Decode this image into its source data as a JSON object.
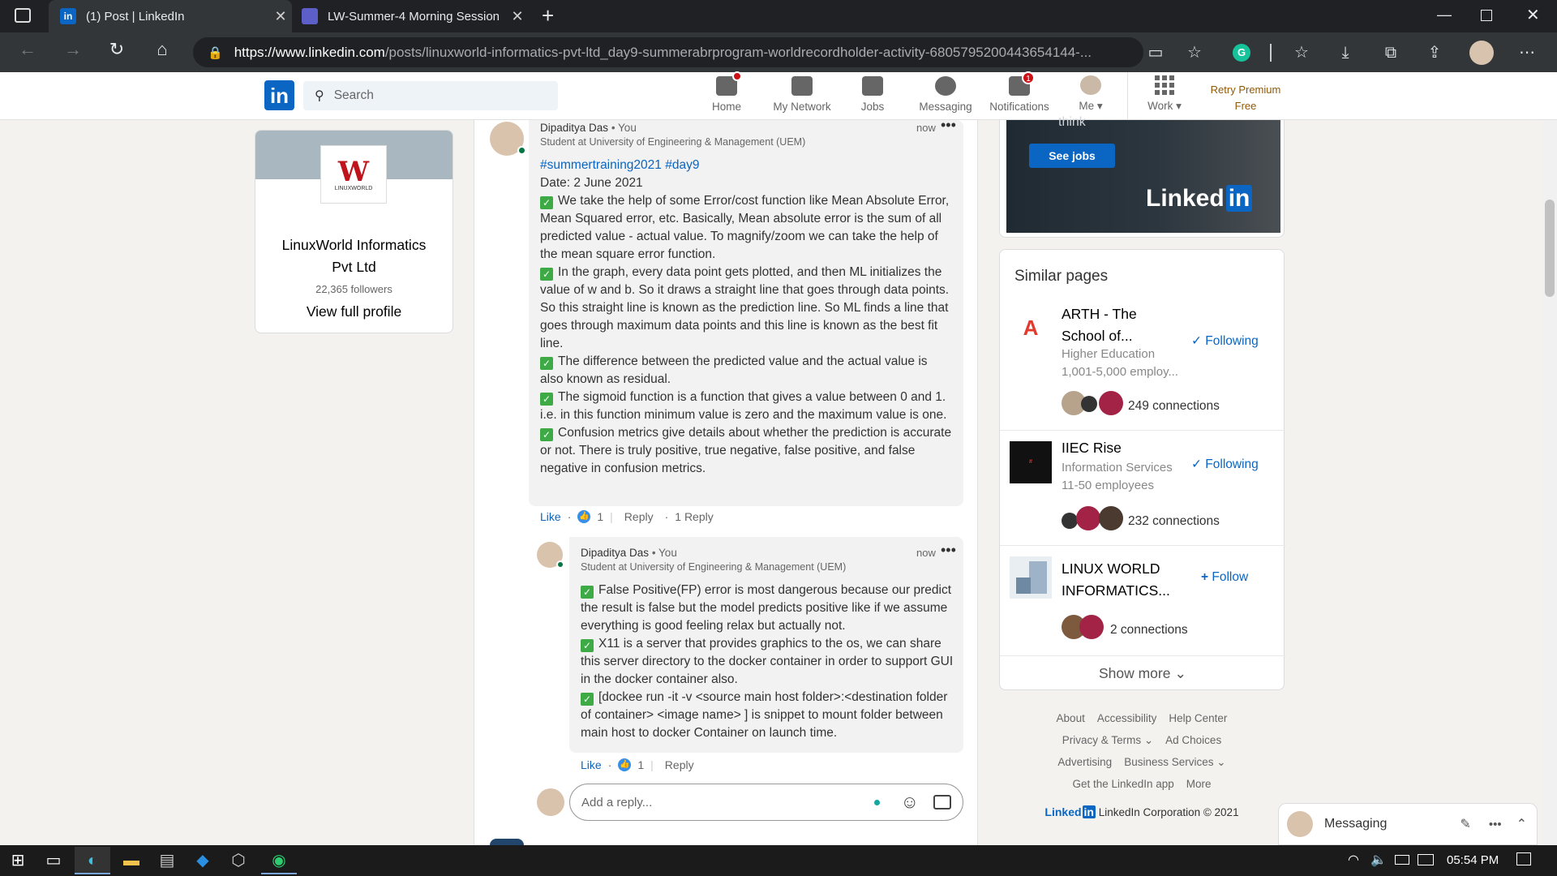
{
  "browser": {
    "tabs": [
      {
        "title": "(1) Post | LinkedIn",
        "icon": "linkedin-icon",
        "active": true
      },
      {
        "title": "LW-Summer-4 Morning Session",
        "icon": "teams-icon",
        "active": false
      }
    ],
    "url_domain": "https://www.linkedin.com",
    "url_path": "/posts/linuxworld-informatics-pvt-ltd_day9-summerabrprogram-worldrecordholder-activity-6805795200443654144-..."
  },
  "nav": {
    "search_placeholder": "Search",
    "items": [
      {
        "label": "Home",
        "badge": "",
        "icon": "home-icon"
      },
      {
        "label": "My Network",
        "badge": "",
        "icon": "network-icon"
      },
      {
        "label": "Jobs",
        "badge": "",
        "icon": "briefcase-icon"
      },
      {
        "label": "Messaging",
        "badge": "",
        "icon": "messaging-icon"
      },
      {
        "label": "Notifications",
        "badge": "1",
        "icon": "bell-icon"
      },
      {
        "label": "Me",
        "badge": "",
        "icon": "avatar"
      },
      {
        "label": "Work",
        "badge": "",
        "icon": "grid-icon"
      }
    ],
    "premium_line1": "Retry Premium",
    "premium_line2": "Free"
  },
  "profile_card": {
    "logo_text": "LINUXWORLD",
    "name_line1": "LinuxWorld Informatics",
    "name_line2": "Pvt Ltd",
    "followers": "22,365 followers",
    "view_profile": "View full profile"
  },
  "comment1": {
    "author": "Dipaditya Das",
    "you": "• You",
    "headline": "Student at University of Engineering & Management (UEM)",
    "time": "now",
    "hashtags": "#summertraining2021 #day9",
    "date": "Date: 2 June 2021",
    "p1": "We take the help of some Error/cost function like Mean Absolute Error, Mean Squared error, etc. Basically, Mean absolute error is the sum of all predicted value - actual value. To magnify/zoom we can take the help of the mean square error function.",
    "p2": "In the graph, every data point gets plotted, and then ML initializes the value of w and b. So it draws a straight line that goes through data points. So this straight line is known as the prediction line. So ML finds a line that goes through maximum data points and this line is known as the best fit line.",
    "p3": "The difference between the predicted value and the actual value is also known as residual.",
    "p4": "The sigmoid function is a function that gives a value between 0 and 1. i.e. in this function minimum value is zero and the maximum value is one.",
    "p5": "Confusion metrics give details about whether the prediction is accurate or not. There is truly positive, true negative, false positive, and false negative in confusion metrics.",
    "like": "Like",
    "like_count": "1",
    "reply": "Reply",
    "replies": "1 Reply"
  },
  "comment2": {
    "author": "Dipaditya Das",
    "you": "• You",
    "headline": "Student at University of Engineering & Management (UEM)",
    "time": "now",
    "p1": "False Positive(FP) error is most dangerous because our predict the result is false but the model predicts positive like if we assume everything is good feeling relax but actually not.",
    "p2": "X11 is a server that provides graphics to the os, we can share this server directory to the docker container in order to support GUI in the docker container also.",
    "p3": "[dockee run -it -v <source main host folder>:<destination folder of container> <image name> ] is snippet to mount folder between main host to docker Container on launch time.",
    "like": "Like",
    "like_count": "1",
    "reply": "Reply"
  },
  "reply_box": {
    "placeholder": "Add a reply..."
  },
  "ad": {
    "text": "think",
    "button": "See jobs",
    "brand": "Linked",
    "brand_in": "in"
  },
  "similar": {
    "title": "Similar pages",
    "pages": [
      {
        "name_line1": "ARTH - The",
        "name_line2": "School of...",
        "category": "Higher Education",
        "size": "1,001-5,000 employ...",
        "action": "Following",
        "connections": "249 connections",
        "logo_color": "#e23b2e"
      },
      {
        "name_line1": "IIEC Rise",
        "name_line2": "",
        "category": "Information Services",
        "size": "11-50 employees",
        "action": "Following",
        "connections": "232 connections",
        "logo_color": "#111111"
      },
      {
        "name_line1": "LINUX WORLD",
        "name_line2": "INFORMATICS...",
        "category": "",
        "size": "",
        "action": "Follow",
        "connections": "2 connections",
        "logo_color": "#9fb3c8"
      }
    ],
    "show_more": "Show more"
  },
  "footer": {
    "links_row1": [
      "About",
      "Accessibility",
      "Help Center"
    ],
    "links_row2": [
      "Privacy & Terms",
      "Ad Choices"
    ],
    "links_row3": [
      "Advertising",
      "Business Services"
    ],
    "links_row4": [
      "Get the LinkedIn app",
      "More"
    ],
    "brand": "Linked",
    "brand_in": "in",
    "copyright": "LinkedIn Corporation © 2021"
  },
  "messaging": {
    "label": "Messaging"
  },
  "taskbar": {
    "time": "05:54 PM"
  }
}
